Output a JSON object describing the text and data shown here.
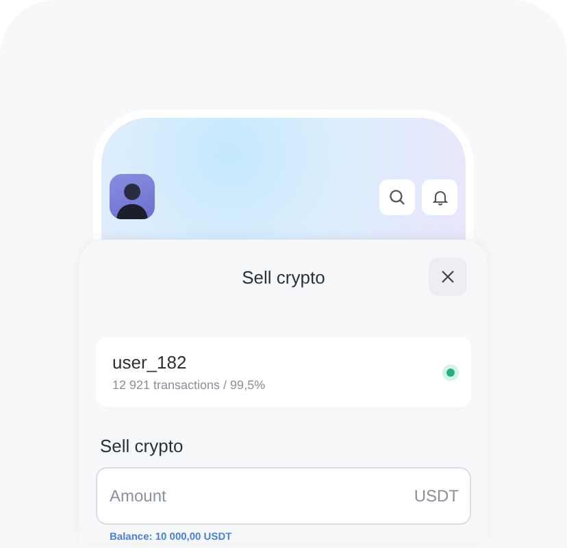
{
  "sheet": {
    "title": "Sell crypto"
  },
  "seller": {
    "name": "user_182",
    "stats": "12 921 transactions / 99,5%",
    "online": true
  },
  "form": {
    "label": "Sell crypto",
    "placeholder": "Amount",
    "currency": "USDT",
    "balance": "Balance: 10 000,00 USDT"
  }
}
